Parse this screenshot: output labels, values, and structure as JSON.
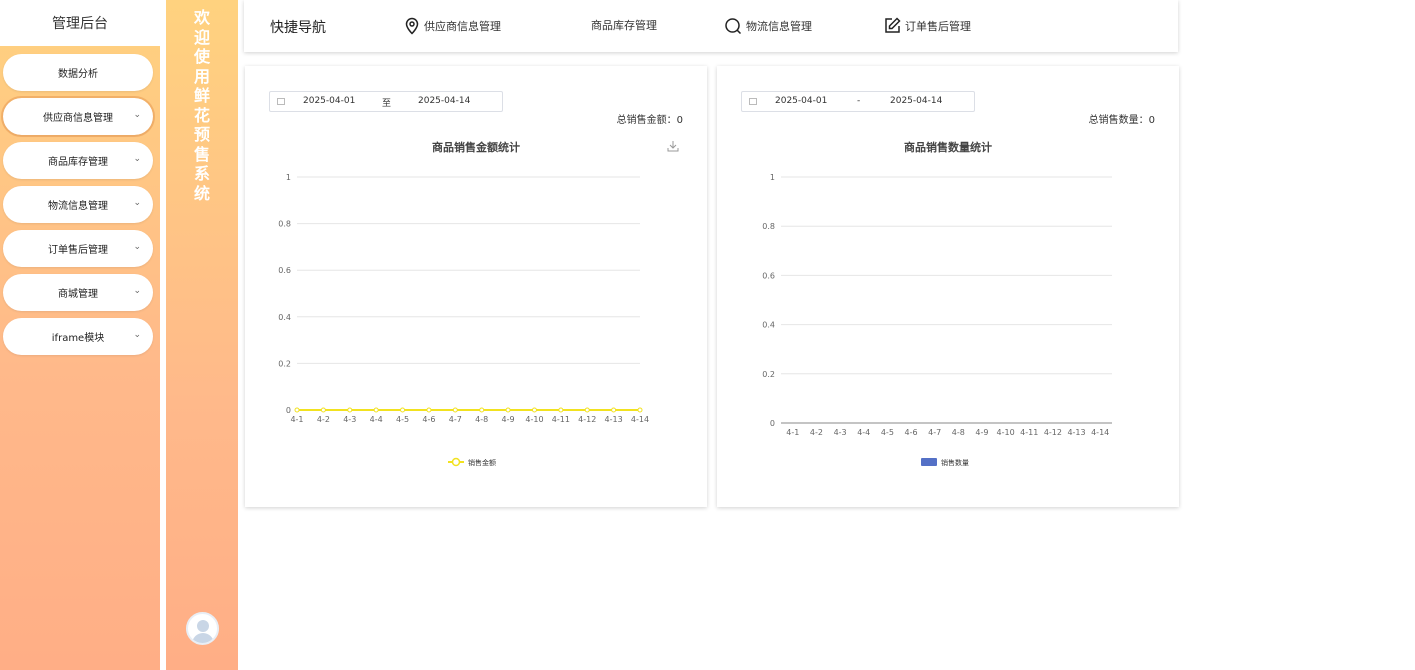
{
  "sidebar": {
    "title": "管理后台",
    "items": [
      {
        "label": "数据分析",
        "chevron": false
      },
      {
        "label": "供应商信息管理",
        "chevron": true
      },
      {
        "label": "商品库存管理",
        "chevron": true
      },
      {
        "label": "物流信息管理",
        "chevron": true
      },
      {
        "label": "订单售后管理",
        "chevron": true
      },
      {
        "label": "商城管理",
        "chevron": true
      },
      {
        "label": "iframe模块",
        "chevron": true
      }
    ]
  },
  "banner": {
    "chars": [
      "欢",
      "迎",
      "使",
      "用",
      "鲜",
      "花",
      "预",
      "售",
      "系",
      "统"
    ]
  },
  "topbar": {
    "title": "快捷导航",
    "links": [
      {
        "label": "供应商信息管理",
        "icon": "location-pin-icon"
      },
      {
        "label": "商品库存管理",
        "icon": ""
      },
      {
        "label": "物流信息管理",
        "icon": "search-icon"
      },
      {
        "label": "订单售后管理",
        "icon": "edit-icon"
      }
    ]
  },
  "card_amount": {
    "date_start": "2025-04-01",
    "date_sep": "至",
    "date_end": "2025-04-14",
    "total": "总销售金额：0"
  },
  "card_quantity": {
    "date_start": "2025-04-01",
    "date_sep": "-",
    "date_end": "2025-04-14",
    "total": "总销售数量：0"
  },
  "chart_data": [
    {
      "type": "line",
      "title": "商品销售金额统计",
      "categories": [
        "4-1",
        "4-2",
        "4-3",
        "4-4",
        "4-5",
        "4-6",
        "4-7",
        "4-8",
        "4-9",
        "4-10",
        "4-11",
        "4-12",
        "4-13",
        "4-14"
      ],
      "series": [
        {
          "name": "销售金额",
          "values": [
            0,
            0,
            0,
            0,
            0,
            0,
            0,
            0,
            0,
            0,
            0,
            0,
            0,
            0
          ],
          "color": "#f2e21f"
        }
      ],
      "ylim": [
        0,
        1
      ],
      "yticks": [
        "0",
        "0.2",
        "0.4",
        "0.6",
        "0.8",
        "1"
      ],
      "grid": true,
      "legend": "bottom-center"
    },
    {
      "type": "bar",
      "title": "商品销售数量统计",
      "categories": [
        "4-1",
        "4-2",
        "4-3",
        "4-4",
        "4-5",
        "4-6",
        "4-7",
        "4-8",
        "4-9",
        "4-10",
        "4-11",
        "4-12",
        "4-13",
        "4-14"
      ],
      "series": [
        {
          "name": "销售数量",
          "values": [
            0,
            0,
            0,
            0,
            0,
            0,
            0,
            0,
            0,
            0,
            0,
            0,
            0,
            0
          ],
          "color": "#5470c6"
        }
      ],
      "ylim": [
        0,
        1
      ],
      "yticks": [
        "0",
        "0.2",
        "0.4",
        "0.6",
        "0.8",
        "1"
      ],
      "grid": true,
      "legend": "bottom-center"
    }
  ]
}
